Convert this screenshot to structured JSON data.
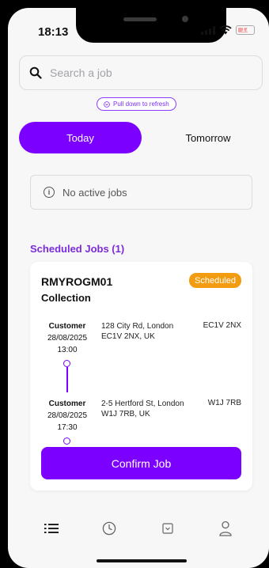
{
  "status_bar": {
    "time": "18:13",
    "battery": "17"
  },
  "search": {
    "placeholder": "Search a job",
    "value": ""
  },
  "refresh_hint": "Pull down to refresh",
  "tabs": [
    {
      "label": "Today",
      "active": true
    },
    {
      "label": "Tomorrow",
      "active": false
    }
  ],
  "active_jobs": {
    "empty_text": "No active jobs"
  },
  "scheduled": {
    "title": "Scheduled Jobs (1)",
    "jobs": [
      {
        "id": "RMYROGM01",
        "type": "Collection",
        "status": "Scheduled",
        "stops": [
          {
            "role": "Customer",
            "date": "28/08/2025",
            "time": "13:00",
            "address": "128 City Rd, London EC1V 2NX, UK",
            "postcode": "EC1V 2NX"
          },
          {
            "role": "Customer",
            "date": "28/08/2025",
            "time": "17:30",
            "address": "2-5 Hertford St, London W1J 7RB, UK",
            "postcode": "W1J 7RB"
          }
        ],
        "action": "Confirm Job"
      }
    ]
  },
  "bottom_nav": [
    {
      "icon": "list-icon",
      "active": true
    },
    {
      "icon": "clock-icon",
      "active": false
    },
    {
      "icon": "inbox-icon",
      "active": false
    },
    {
      "icon": "user-icon",
      "active": false
    }
  ],
  "colors": {
    "accent": "#7b00ff",
    "badge": "#f39c12",
    "section_title": "#7b2cd8",
    "background": "#f7f7f8"
  }
}
